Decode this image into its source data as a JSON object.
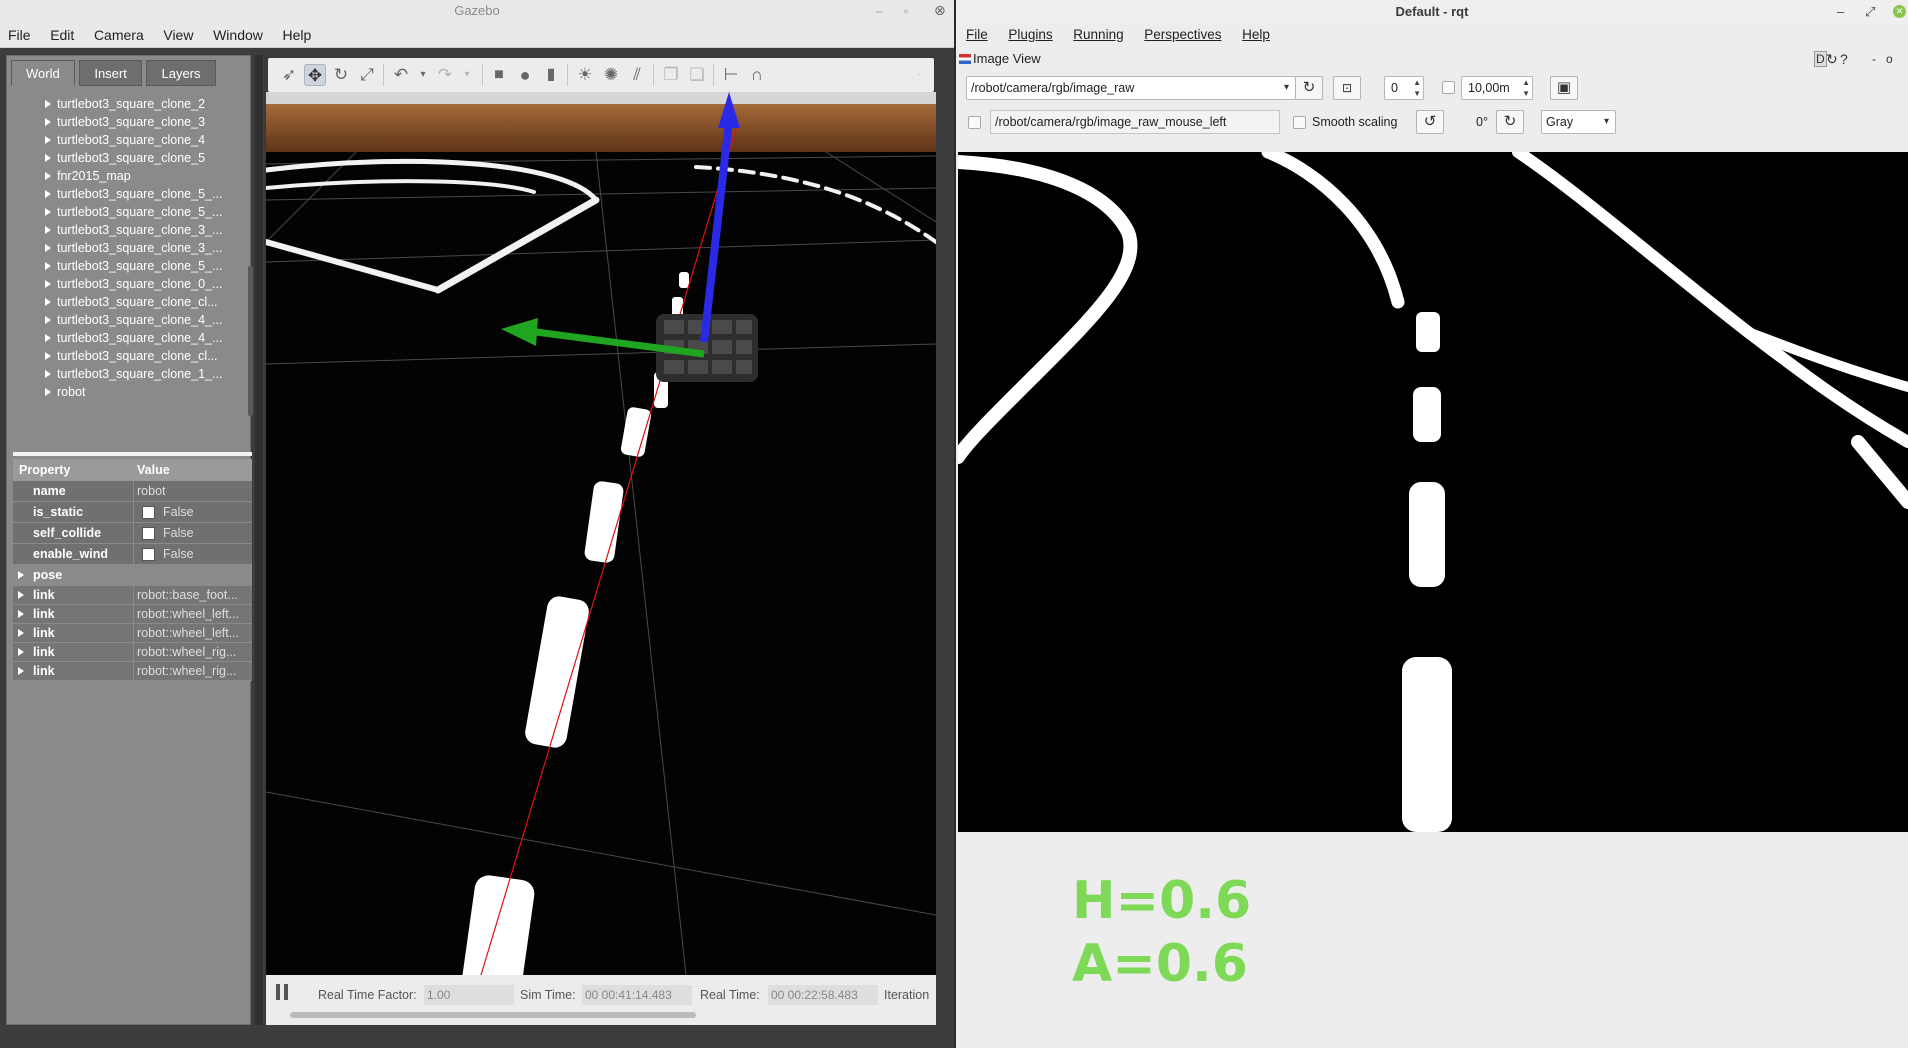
{
  "gazebo": {
    "title": "Gazebo",
    "menu": [
      "File",
      "Edit",
      "Camera",
      "View",
      "Window",
      "Help"
    ],
    "tabs": [
      "World",
      "Insert",
      "Layers"
    ],
    "tree_items": [
      "turtlebot3_square_clone_2",
      "turtlebot3_square_clone_3",
      "turtlebot3_square_clone_4",
      "turtlebot3_square_clone_5",
      "fnr2015_map",
      "turtlebot3_square_clone_5_...",
      "turtlebot3_square_clone_5_...",
      "turtlebot3_square_clone_3_...",
      "turtlebot3_square_clone_3_...",
      "turtlebot3_square_clone_5_...",
      "turtlebot3_square_clone_0_...",
      "turtlebot3_square_clone_cl...",
      "turtlebot3_square_clone_4_...",
      "turtlebot3_square_clone_4_...",
      "turtlebot3_square_clone_cl...",
      "turtlebot3_square_clone_1_...",
      "robot"
    ],
    "properties": {
      "header_property": "Property",
      "header_value": "Value",
      "name_key": "name",
      "name_value": "robot",
      "is_static_key": "is_static",
      "self_collide_key": "self_collide",
      "enable_wind_key": "enable_wind",
      "false_label": "False",
      "pose_key": "pose",
      "links": [
        {
          "key": "link",
          "value": "robot::base_foot..."
        },
        {
          "key": "link",
          "value": "robot::wheel_left..."
        },
        {
          "key": "link",
          "value": "robot::wheel_left..."
        },
        {
          "key": "link",
          "value": "robot::wheel_rig..."
        },
        {
          "key": "link",
          "value": "robot::wheel_rig..."
        }
      ]
    },
    "status": {
      "rtf_label": "Real Time Factor:",
      "rtf_value": "1.00",
      "sim_time_label": "Sim Time:",
      "sim_time_value": "00 00:41:14.483",
      "real_time_label": "Real Time:",
      "real_time_value": "00 00:22:58.483",
      "iterations_label": "Iteration"
    }
  },
  "rqt": {
    "title": "Default - rqt",
    "menu": [
      "File",
      "Plugins",
      "Running",
      "Perspectives",
      "Help"
    ],
    "plugin_title": "Image View",
    "plugin_controls": "D",
    "topic": "/robot/camera/rgb/image_raw",
    "spin_value": "0",
    "max_range": "10,00m",
    "mouse_topic": "/robot/camera/rgb/image_raw_mouse_left",
    "smooth_scaling_label": "Smooth scaling",
    "rotation": "0°",
    "color_scheme": "Gray",
    "hud_h": "H=0.6",
    "hud_a": "A=0.6"
  },
  "colors": {
    "hud_green": "#7ed957",
    "tf_x": "#1fa51f",
    "tf_z": "#2020e0",
    "floor_wood": "#7a4a24"
  }
}
